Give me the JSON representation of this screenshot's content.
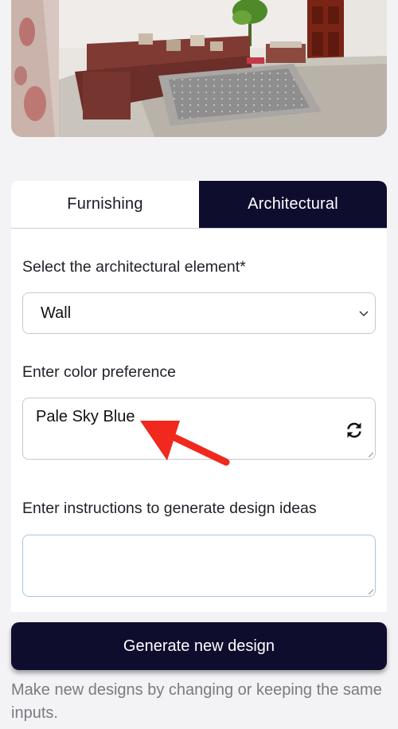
{
  "colors": {
    "brand_dark": "#0f0d2e",
    "background": "#f3f3f5",
    "annotation_arrow": "#f0281e"
  },
  "tabs": [
    {
      "label": "Furnishing",
      "active": false
    },
    {
      "label": "Architectural",
      "active": true
    }
  ],
  "form": {
    "element_label": "Select the architectural element*",
    "element_value": "Wall",
    "color_label": "Enter color preference",
    "color_value": "Pale Sky Blue",
    "instructions_label": "Enter instructions to generate design ideas",
    "instructions_value": ""
  },
  "actions": {
    "generate_label": "Generate new design"
  },
  "hint_text": "Make new designs by changing or keeping the same inputs.",
  "icons": {
    "select_chevron": "chevron-down-icon",
    "refresh": "refresh-icon",
    "annotation": "red-arrow-icon"
  }
}
